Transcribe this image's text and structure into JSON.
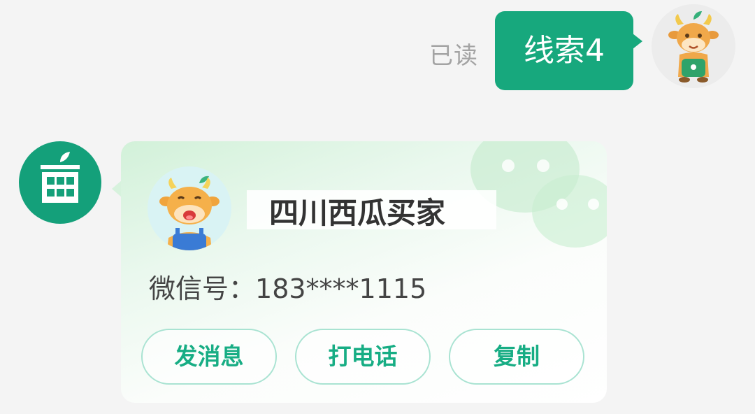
{
  "outgoing_message": {
    "read_status": "已读",
    "text": "线索4"
  },
  "contact_card": {
    "buyer_name": "四川西瓜买家",
    "wechat_label": "微信号：",
    "wechat_id": "183****1115",
    "buttons": {
      "send_message": "发消息",
      "call": "打电话",
      "copy": "复制"
    }
  },
  "colors": {
    "accent": "#17a87d",
    "button_text": "#17ad84",
    "read_status": "#a3a3a3"
  },
  "icons": {
    "my_avatar": "cow-mascot-avatar",
    "bot_avatar": "building-icon",
    "buyer_avatar": "cow-mascot-avatar",
    "watermark": "wechat-icon"
  }
}
